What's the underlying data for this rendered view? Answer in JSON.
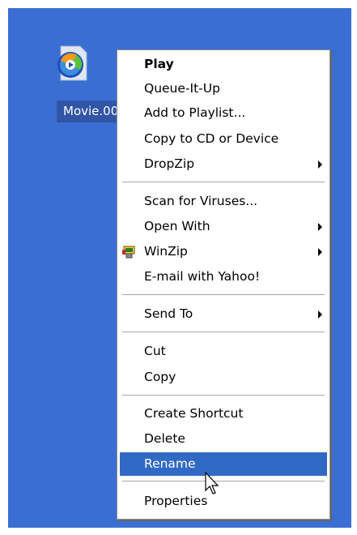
{
  "desktop_icon": {
    "label": "Movie.00",
    "icon": "media-player-file-icon"
  },
  "menu": {
    "items": [
      {
        "label": "Play",
        "bold": true
      },
      {
        "label": "Queue-It-Up"
      },
      {
        "label": "Add to Playlist..."
      },
      {
        "label": "Copy to CD or Device"
      },
      {
        "label": "DropZip",
        "submenu": true
      },
      {
        "label": "Scan for Viruses..."
      },
      {
        "label": "Open With",
        "submenu": true
      },
      {
        "label": "WinZip",
        "submenu": true,
        "icon": "winzip-icon"
      },
      {
        "label": "E-mail with Yahoo!"
      },
      {
        "label": "Send To",
        "submenu": true
      },
      {
        "label": "Cut"
      },
      {
        "label": "Copy"
      },
      {
        "label": "Create Shortcut"
      },
      {
        "label": "Delete"
      },
      {
        "label": "Rename",
        "selected": true
      },
      {
        "label": "Properties"
      }
    ]
  },
  "colors": {
    "desktop": "#3a6ed3",
    "selection": "#316ac5",
    "label_highlight": "#3155a6"
  }
}
